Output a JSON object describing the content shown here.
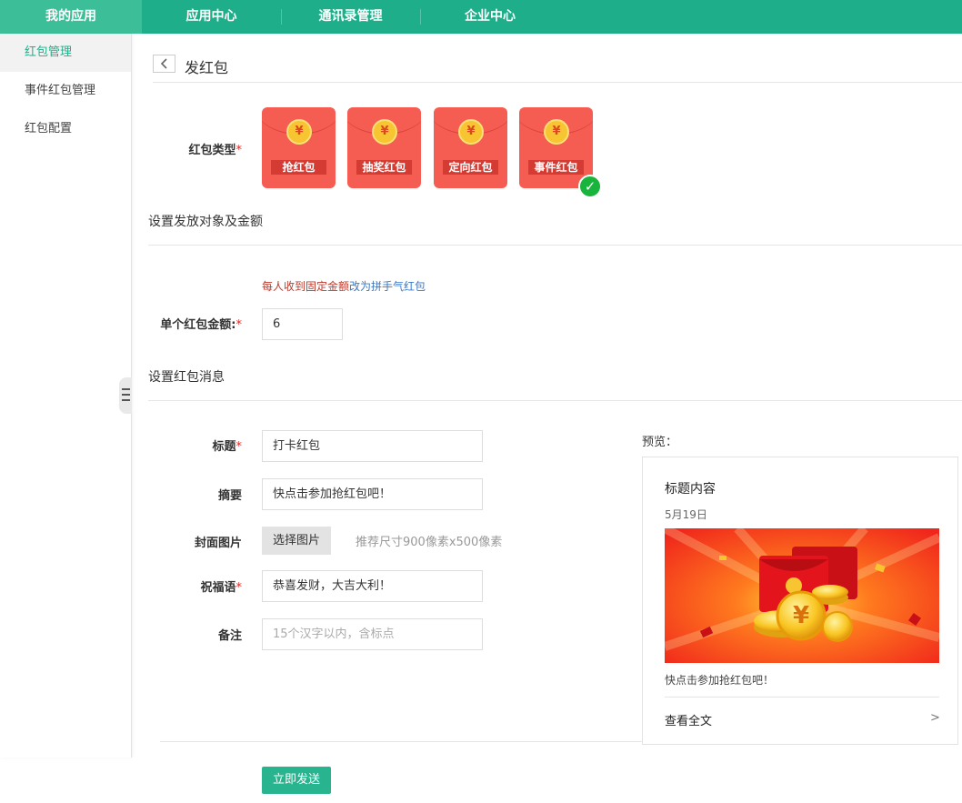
{
  "topnav": {
    "tabs": [
      {
        "label": "我的应用"
      },
      {
        "label": "应用中心"
      },
      {
        "label": "通讯录管理"
      },
      {
        "label": "企业中心"
      }
    ]
  },
  "sidebar": {
    "items": [
      {
        "label": "红包管理"
      },
      {
        "label": "事件红包管理"
      },
      {
        "label": "红包配置"
      }
    ]
  },
  "header": {
    "back_icon": "chevron-left-icon",
    "title": "发红包"
  },
  "form": {
    "type_label": "红包类型",
    "types": [
      {
        "coin": "¥",
        "label": "抢红包"
      },
      {
        "coin": "¥",
        "label": "抽奖红包"
      },
      {
        "coin": "¥",
        "label": "定向红包"
      },
      {
        "coin": "¥",
        "label": "事件红包"
      }
    ],
    "section_amount": "设置发放对象及金额",
    "amount_hint_fixed": "每人收到固定金额",
    "amount_hint_switch": "改为拼手气红包",
    "amount_label": "单个红包金额:",
    "amount_value": "6",
    "section_message": "设置红包消息",
    "title_label": "标题",
    "title_value": "打卡红包",
    "summary_label": "摘要",
    "summary_value": "快点击参加抢红包吧！",
    "cover_label": "封面图片",
    "cover_button": "选择图片",
    "cover_hint": "推荐尺寸900像素x500像素",
    "blessing_label": "祝福语",
    "blessing_value": "恭喜发财，大吉大利！",
    "note_label": "备注",
    "note_placeholder": "15个汉字以内，含标点",
    "submit": "立即发送"
  },
  "preview": {
    "label": "预览：",
    "title": "标题内容",
    "date": "5月19日",
    "summary": "快点击参加抢红包吧！",
    "read_more": "查看全文",
    "arrow": ">"
  },
  "colors": {
    "brand": "#1fae8a",
    "envelope": "#f55d52",
    "check": "#18b43c"
  }
}
